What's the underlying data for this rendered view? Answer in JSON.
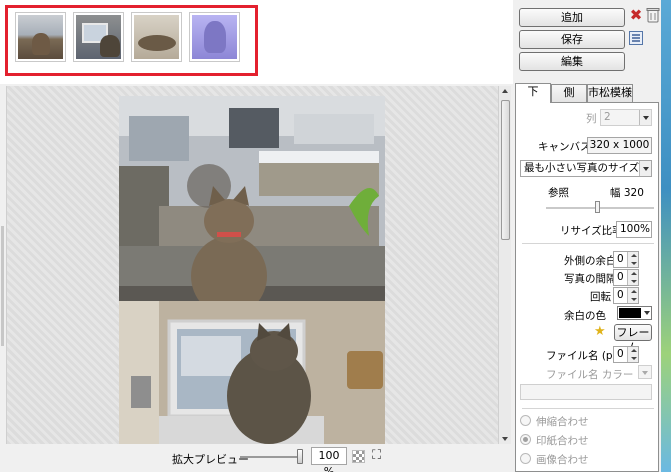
{
  "toolbar": {
    "add_label": "追加",
    "save_label": "保存",
    "edit_label": "編集"
  },
  "thumbnails": [
    {
      "name": "thumb-1",
      "tint": "#9aa4ad"
    },
    {
      "name": "thumb-2",
      "tint": "#6c7f90"
    },
    {
      "name": "thumb-3",
      "tint": "#b0a38f"
    },
    {
      "name": "thumb-4",
      "tint": "#a9a3e6"
    }
  ],
  "colors": {
    "highlight": "#e3202e",
    "accent_delete": "#c62b2b"
  },
  "tabs": [
    {
      "label": "下",
      "active": true
    },
    {
      "label": "側",
      "active": false
    },
    {
      "label": "市松模様",
      "active": false
    }
  ],
  "panel": {
    "columns_label": "列",
    "columns_value": "2",
    "canvas_label": "キャンバス",
    "canvas_value": "320 x 1000",
    "size_mode": "最も小さい写真のサイズ",
    "reference_label": "参照",
    "reference_value": "幅 320",
    "resize_ratio_label": "リサイズ比率",
    "resize_ratio_value": "100%",
    "outer_margin_label": "外側の余白",
    "outer_margin_value": "0",
    "photo_spacing_label": "写真の間隔",
    "photo_spacing_value": "0",
    "rotation_label": "回転",
    "rotation_value": "0",
    "margin_color_label": "余白の色",
    "margin_color_value": "#000000",
    "frame_button_label": "フレーム",
    "filename_label": "ファイル名 (px)",
    "filename_value": "0",
    "filename_color_label": "ファイル名 カラー",
    "fit_options": [
      {
        "label": "伸縮合わせ",
        "selected": false
      },
      {
        "label": "印紙合わせ",
        "selected": true
      },
      {
        "label": "画像合わせ",
        "selected": false
      }
    ]
  },
  "bottom": {
    "zoom_label": "拡大プレビュー",
    "zoom_value": "100 %",
    "zoom_level": 1.0
  }
}
